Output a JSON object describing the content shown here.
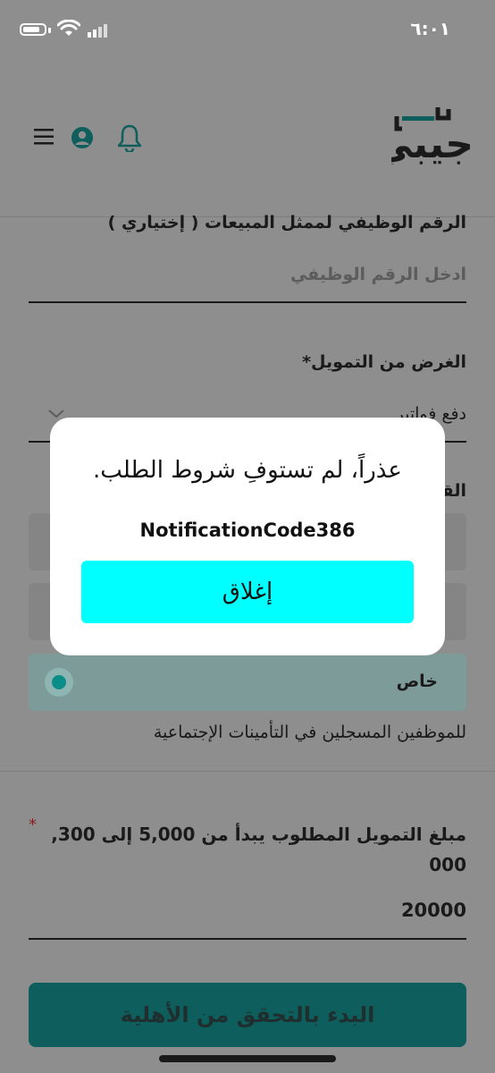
{
  "status_bar": {
    "time": "٦:٠١"
  },
  "header": {
    "logo_text": "جيبي"
  },
  "form": {
    "employee_id_label": "الرقم الوظيفي لممثل المبيعات ( إختياري )",
    "employee_id_placeholder": "ادخل الرقم الوظيفي",
    "purpose_label": "الغرض من التمويل*",
    "purpose_value": "دفع فواتير",
    "sector_label": "القطاع",
    "private_option": "خاص",
    "helper_text": "للموظفين المسجلين في التأمينات الإجتماعية",
    "amount_label": "مبلغ التمويل المطلوب يبدأ من 5,000 إلى 300, 000",
    "required_mark": "*",
    "amount_value": "20000",
    "submit_label": "البدء بالتحقق من الأهلية"
  },
  "modal": {
    "title": "عذراً، لم تستوفِ شروط الطلب.",
    "code": "NotificationCode386",
    "close_label": "إغلاق"
  },
  "colors": {
    "accent_teal": "#0d5e5c",
    "close_button": "#00ffff",
    "overlay_gray": "#8e8e8e"
  }
}
